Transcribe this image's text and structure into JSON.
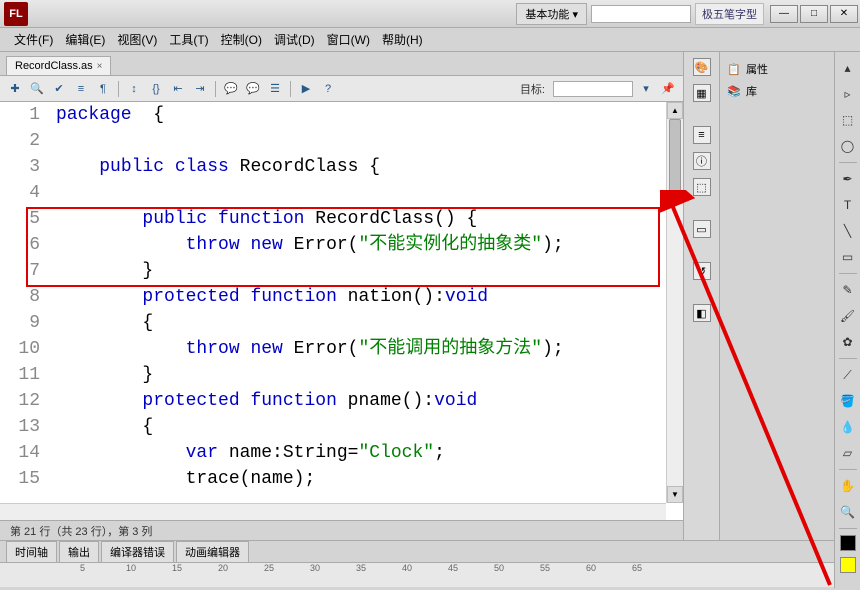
{
  "titlebar": {
    "app": "FL",
    "workspace": "基本功能 ▾",
    "search_placeholder": "",
    "ime": "极五笔字型"
  },
  "window_buttons": {
    "min": "—",
    "max": "□",
    "close": "✕"
  },
  "menu": [
    "文件(F)",
    "编辑(E)",
    "视图(V)",
    "工具(T)",
    "控制(O)",
    "调试(D)",
    "窗口(W)",
    "帮助(H)"
  ],
  "tab": {
    "name": "RecordClass.as",
    "close": "×"
  },
  "toolbar": {
    "target_label": "目标:"
  },
  "code": {
    "lines": [
      {
        "n": 1,
        "tokens": [
          [
            "kw",
            "package"
          ],
          [
            "",
            "  {"
          ]
        ]
      },
      {
        "n": 2,
        "tokens": [
          [
            "",
            ""
          ]
        ]
      },
      {
        "n": 3,
        "tokens": [
          [
            "",
            "    "
          ],
          [
            "kw",
            "public"
          ],
          [
            "",
            ""
          ],
          [
            "kw",
            " class"
          ],
          [
            "",
            " RecordClass {"
          ]
        ]
      },
      {
        "n": 4,
        "tokens": [
          [
            "",
            ""
          ]
        ]
      },
      {
        "n": 5,
        "tokens": [
          [
            "",
            "        "
          ],
          [
            "kw",
            "public"
          ],
          [
            "",
            " "
          ],
          [
            "kw",
            "function"
          ],
          [
            "",
            " RecordClass() {"
          ]
        ]
      },
      {
        "n": 6,
        "tokens": [
          [
            "",
            "            "
          ],
          [
            "kw",
            "throw"
          ],
          [
            "",
            " "
          ],
          [
            "kw",
            "new"
          ],
          [
            "",
            " Error("
          ],
          [
            "str",
            "\"不能实例化的抽象类\""
          ],
          [
            "",
            ");"
          ]
        ]
      },
      {
        "n": 7,
        "tokens": [
          [
            "",
            "        }"
          ]
        ]
      },
      {
        "n": 8,
        "tokens": [
          [
            "",
            "        "
          ],
          [
            "kw",
            "protected"
          ],
          [
            "",
            " "
          ],
          [
            "kw",
            "function"
          ],
          [
            "",
            " nation():"
          ],
          [
            "kw",
            "void"
          ]
        ]
      },
      {
        "n": 9,
        "tokens": [
          [
            "",
            "        {"
          ]
        ]
      },
      {
        "n": 10,
        "tokens": [
          [
            "",
            "            "
          ],
          [
            "kw",
            "throw"
          ],
          [
            "",
            " "
          ],
          [
            "kw",
            "new"
          ],
          [
            "",
            " Error("
          ],
          [
            "str",
            "\"不能调用的抽象方法\""
          ],
          [
            "",
            ");"
          ]
        ]
      },
      {
        "n": 11,
        "tokens": [
          [
            "",
            "        }"
          ]
        ]
      },
      {
        "n": 12,
        "tokens": [
          [
            "",
            "        "
          ],
          [
            "kw",
            "protected"
          ],
          [
            "",
            " "
          ],
          [
            "kw",
            "function"
          ],
          [
            "",
            " pname():"
          ],
          [
            "kw",
            "void"
          ]
        ]
      },
      {
        "n": 13,
        "tokens": [
          [
            "",
            "        {"
          ]
        ]
      },
      {
        "n": 14,
        "tokens": [
          [
            "",
            "            "
          ],
          [
            "kw",
            "var"
          ],
          [
            "",
            " name:String="
          ],
          [
            "str",
            "\"Clock\""
          ],
          [
            "",
            ";"
          ]
        ]
      },
      {
        "n": 15,
        "tokens": [
          [
            "",
            "            trace(name);"
          ]
        ]
      }
    ]
  },
  "status": "第 21 行（共 23 行），第 3 列",
  "bottom_tabs": [
    "时间轴",
    "输出",
    "编译器错误",
    "动画编辑器"
  ],
  "ruler": [
    "5",
    "10",
    "15",
    "20",
    "25",
    "30",
    "35",
    "40",
    "45",
    "50",
    "55",
    "60",
    "65"
  ],
  "right_panels": {
    "properties": "属性",
    "library": "库"
  },
  "swatches": {
    "stroke": "#000000",
    "fill": "#ffff00"
  }
}
